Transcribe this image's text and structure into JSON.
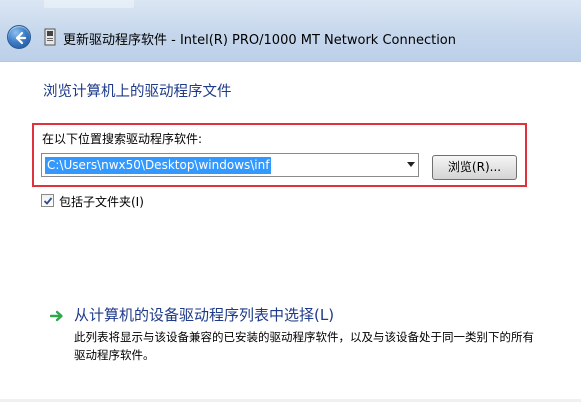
{
  "window": {
    "title": "更新驱动程序软件 - Intel(R) PRO/1000 MT Network Connection"
  },
  "page": {
    "heading": "浏览计算机上的驱动程序文件"
  },
  "search": {
    "label": "在以下位置搜索驱动程序软件:",
    "path_value": "C:\\Users\\nwx50\\Desktop\\windows\\inf",
    "browse_label": "浏览(R)..."
  },
  "subfolders": {
    "label": "包括子文件夹(I)",
    "checked": true
  },
  "pick_option": {
    "title": "从计算机的设备驱动程序列表中选择(L)",
    "description": "此列表将显示与该设备兼容的已安装的驱动程序软件，以及与该设备处于同一类别下的所有驱动程序软件。"
  },
  "icons": {
    "back": "back-arrow-icon",
    "title": "device-icon",
    "option": "green-arrow-icon"
  },
  "colors": {
    "heading": "#1e3a8a",
    "highlight": "#e0323a",
    "selection": "#3399ff"
  }
}
